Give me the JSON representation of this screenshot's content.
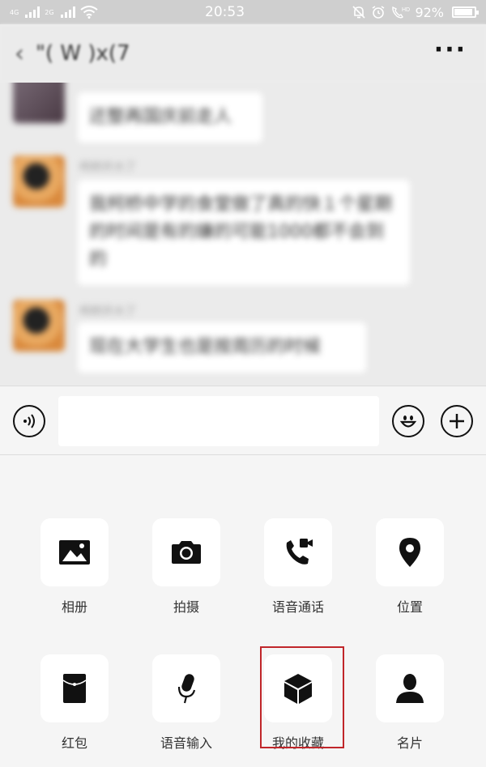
{
  "status_bar": {
    "signal1_tag": "4G",
    "signal2_tag": "2G",
    "time": "20:53",
    "battery": "92%",
    "hd_tag": "HD"
  },
  "header": {
    "back_icon": "chevron-left-icon",
    "title": "\"( W )x(7",
    "more_icon": "more-dots-icon"
  },
  "messages": [
    {
      "sender": "",
      "text": "还整再国庆前走人"
    },
    {
      "sender": "柯桥开大了",
      "text": "我柯桥中学的食堂做了真的快１个星期的时间是有的嫌的可能1000都不会到的"
    },
    {
      "sender": "柯桥开大了",
      "text": "现在大学生也是按周历的时候"
    }
  ],
  "input_bar": {
    "voice_icon": "voice-icon",
    "emoji_icon": "emoji-icon",
    "plus_icon": "plus-icon",
    "text_value": ""
  },
  "panel": {
    "items": [
      {
        "label": "相册",
        "icon": "album-icon"
      },
      {
        "label": "拍摄",
        "icon": "camera-icon"
      },
      {
        "label": "语音通话",
        "icon": "voice-call-icon"
      },
      {
        "label": "位置",
        "icon": "location-icon"
      },
      {
        "label": "红包",
        "icon": "red-packet-icon"
      },
      {
        "label": "语音输入",
        "icon": "microphone-icon"
      },
      {
        "label": "我的收藏",
        "icon": "favorites-icon"
      },
      {
        "label": "名片",
        "icon": "contact-card-icon"
      }
    ],
    "highlighted_item": "我的收藏",
    "highlight_color": "#c0262a"
  }
}
